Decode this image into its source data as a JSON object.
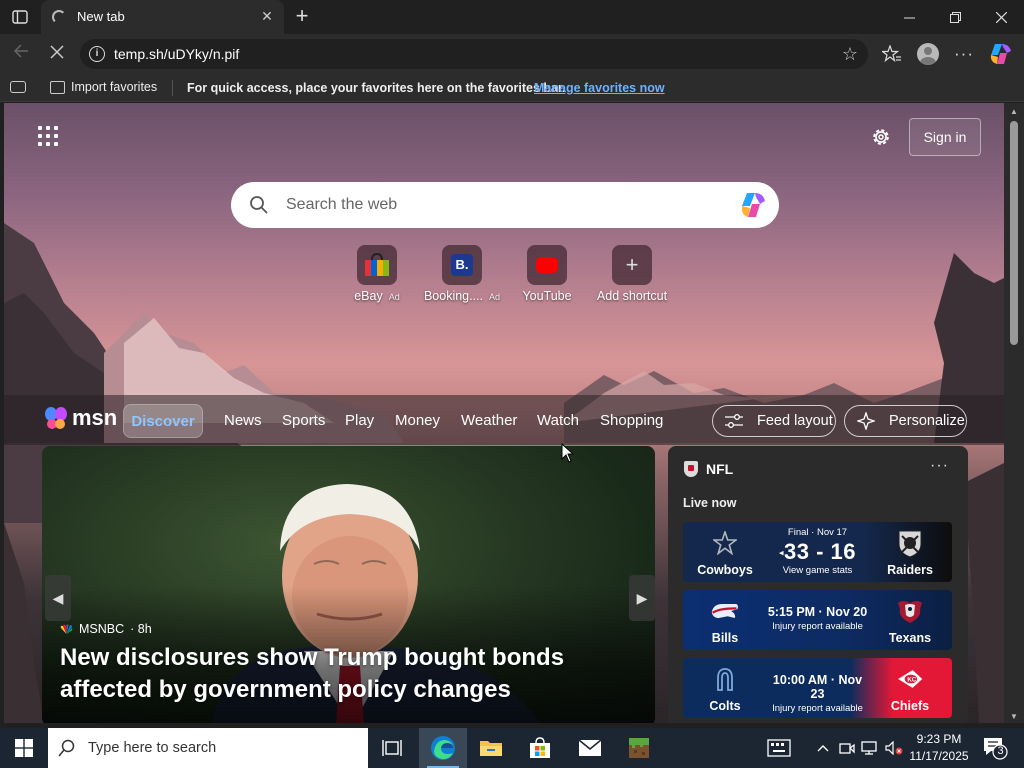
{
  "browser": {
    "tab_title": "New tab",
    "url": "temp.sh/uDYky/n.pif",
    "favorites_bar": {
      "import_label": "Import favorites",
      "message": "For quick access, place your favorites here on the favorites bar.",
      "manage_link": "Manage favorites now"
    }
  },
  "newtab": {
    "sign_in": "Sign in",
    "search_placeholder": "Search the web",
    "shortcuts": [
      {
        "label": "eBay",
        "ad": "Ad",
        "icon": "ebay-bag-icon"
      },
      {
        "label": "Booking....",
        "ad": "Ad",
        "icon": "booking-icon",
        "glyph": "B."
      },
      {
        "label": "YouTube",
        "ad": "",
        "icon": "youtube-icon"
      },
      {
        "label": "Add shortcut",
        "ad": "",
        "icon": "plus-icon"
      }
    ]
  },
  "feed": {
    "brand": "msn",
    "tabs": [
      "Discover",
      "News",
      "Sports",
      "Play",
      "Money",
      "Weather",
      "Watch",
      "Shopping"
    ],
    "active_tab": "Discover",
    "feed_layout": "Feed layout",
    "personalize": "Personalize",
    "hero": {
      "source": "MSNBC",
      "age": "· 8h",
      "headline": "New disclosures show Trump bought bonds affected by government policy changes"
    },
    "nfl": {
      "title": "NFL",
      "live_now": "Live now",
      "games": [
        {
          "home": "Cowboys",
          "away": "Raiders",
          "status": "Final · Nov 17",
          "score": "33 - 16",
          "sub": "View game stats",
          "home_color": "#162a4d",
          "away_color": "#111111"
        },
        {
          "home": "Bills",
          "away": "Texans",
          "time": "5:15 PM · Nov 20",
          "sub": "Injury report available",
          "home_color": "#0d2d6e",
          "away_color": "#0d2347"
        },
        {
          "home": "Colts",
          "away": "Chiefs",
          "time": "10:00 AM · Nov 23",
          "sub": "Injury report available",
          "home_color": "#0c2d5e",
          "away_color": "#e31837"
        }
      ]
    }
  },
  "taskbar": {
    "search_placeholder": "Type here to search",
    "time": "9:23 PM",
    "date": "11/17/2025",
    "notification_count": "3"
  }
}
